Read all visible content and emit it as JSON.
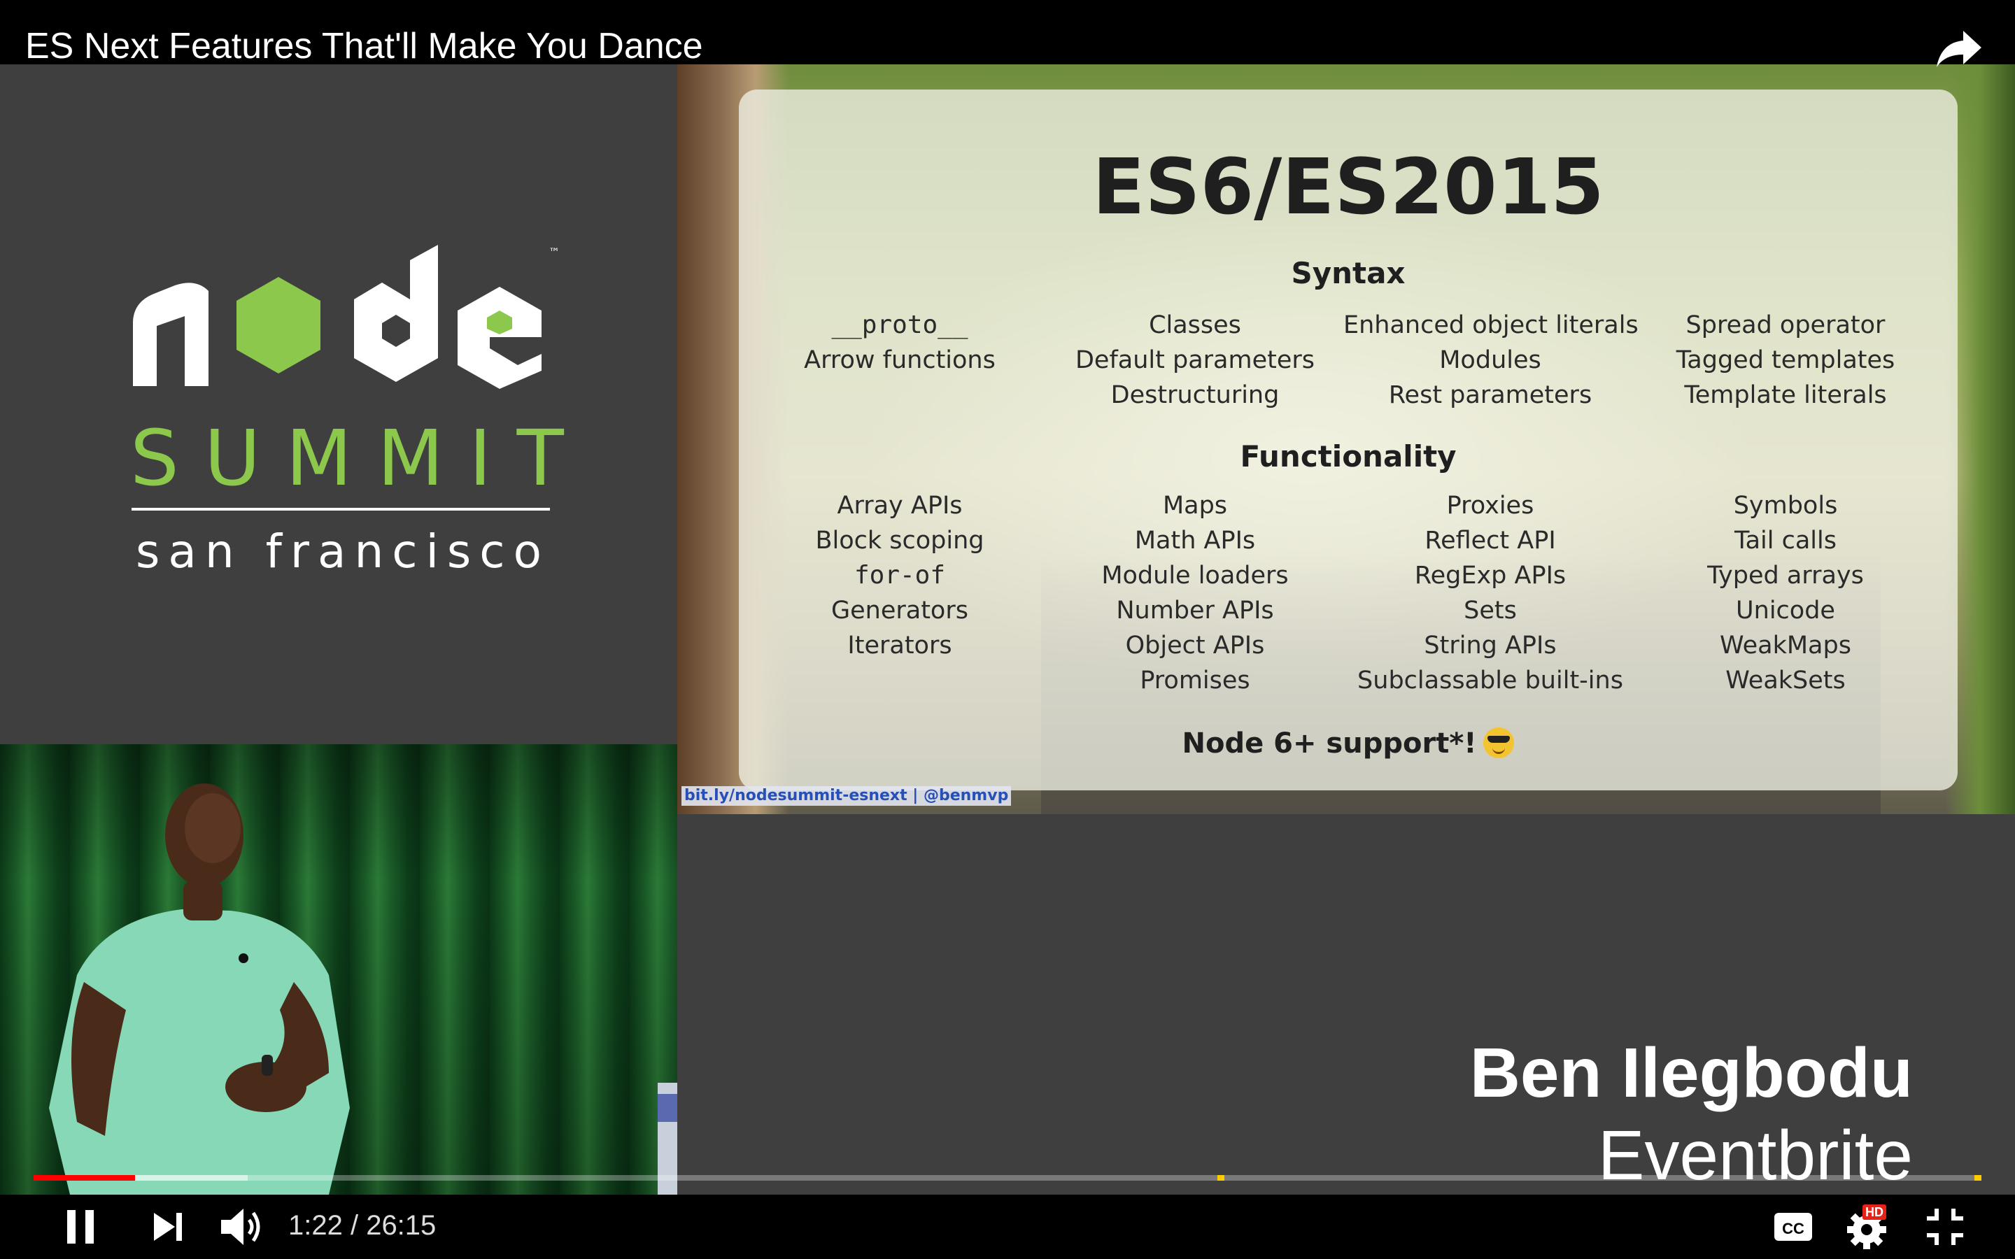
{
  "video": {
    "title": "ES Next Features That'll Make You Dance"
  },
  "logo": {
    "wordmark": "node",
    "trademark": "™",
    "event": "SUMMIT",
    "city": "san francisco",
    "colors": {
      "green": "#8cc84b",
      "white": "#ffffff"
    }
  },
  "slide": {
    "title": "ES6/ES2015",
    "syntax_heading": "Syntax",
    "syntax_columns": [
      [
        "__proto__",
        "Arrow functions"
      ],
      [
        "Classes",
        "Default parameters",
        "Destructuring"
      ],
      [
        "Enhanced object literals",
        "Modules",
        "Rest parameters"
      ],
      [
        "Spread operator",
        "Tagged templates",
        "Template literals"
      ]
    ],
    "functionality_heading": "Functionality",
    "functionality_columns": [
      [
        "Array APIs",
        "Block scoping",
        "for-of",
        "Generators",
        "Iterators"
      ],
      [
        "Maps",
        "Math APIs",
        "Module loaders",
        "Number APIs",
        "Object APIs",
        "Promises"
      ],
      [
        "Proxies",
        "Reflect API",
        "RegExp APIs",
        "Sets",
        "String APIs",
        "Subclassable built-ins"
      ],
      [
        "Symbols",
        "Tail calls",
        "Typed arrays",
        "Unicode",
        "WeakMaps",
        "WeakSets"
      ]
    ],
    "support_text": "Node 6+ support*!",
    "support_icon": "sunglasses-emoji-icon",
    "link_text": "bit.ly/nodesummit-esnext | @benmvp"
  },
  "speaker": {
    "name": "Ben Ilegbodu",
    "company": "Eventbrite"
  },
  "player": {
    "time": "1:22 / 26:15",
    "progress_played": 0.052,
    "progress_buffered": 0.11,
    "icons": {
      "share": "share-icon",
      "pause": "pause-icon",
      "next": "next-icon",
      "volume": "volume-icon",
      "captions": "cc-icon",
      "settings": "gear-icon",
      "exit_fullscreen": "exit-fullscreen-icon"
    },
    "hd_label": "HD",
    "cc_label": "CC",
    "colors": {
      "played": "#ff0000",
      "marker": "#ffcc00",
      "hd": "#e62117"
    }
  }
}
